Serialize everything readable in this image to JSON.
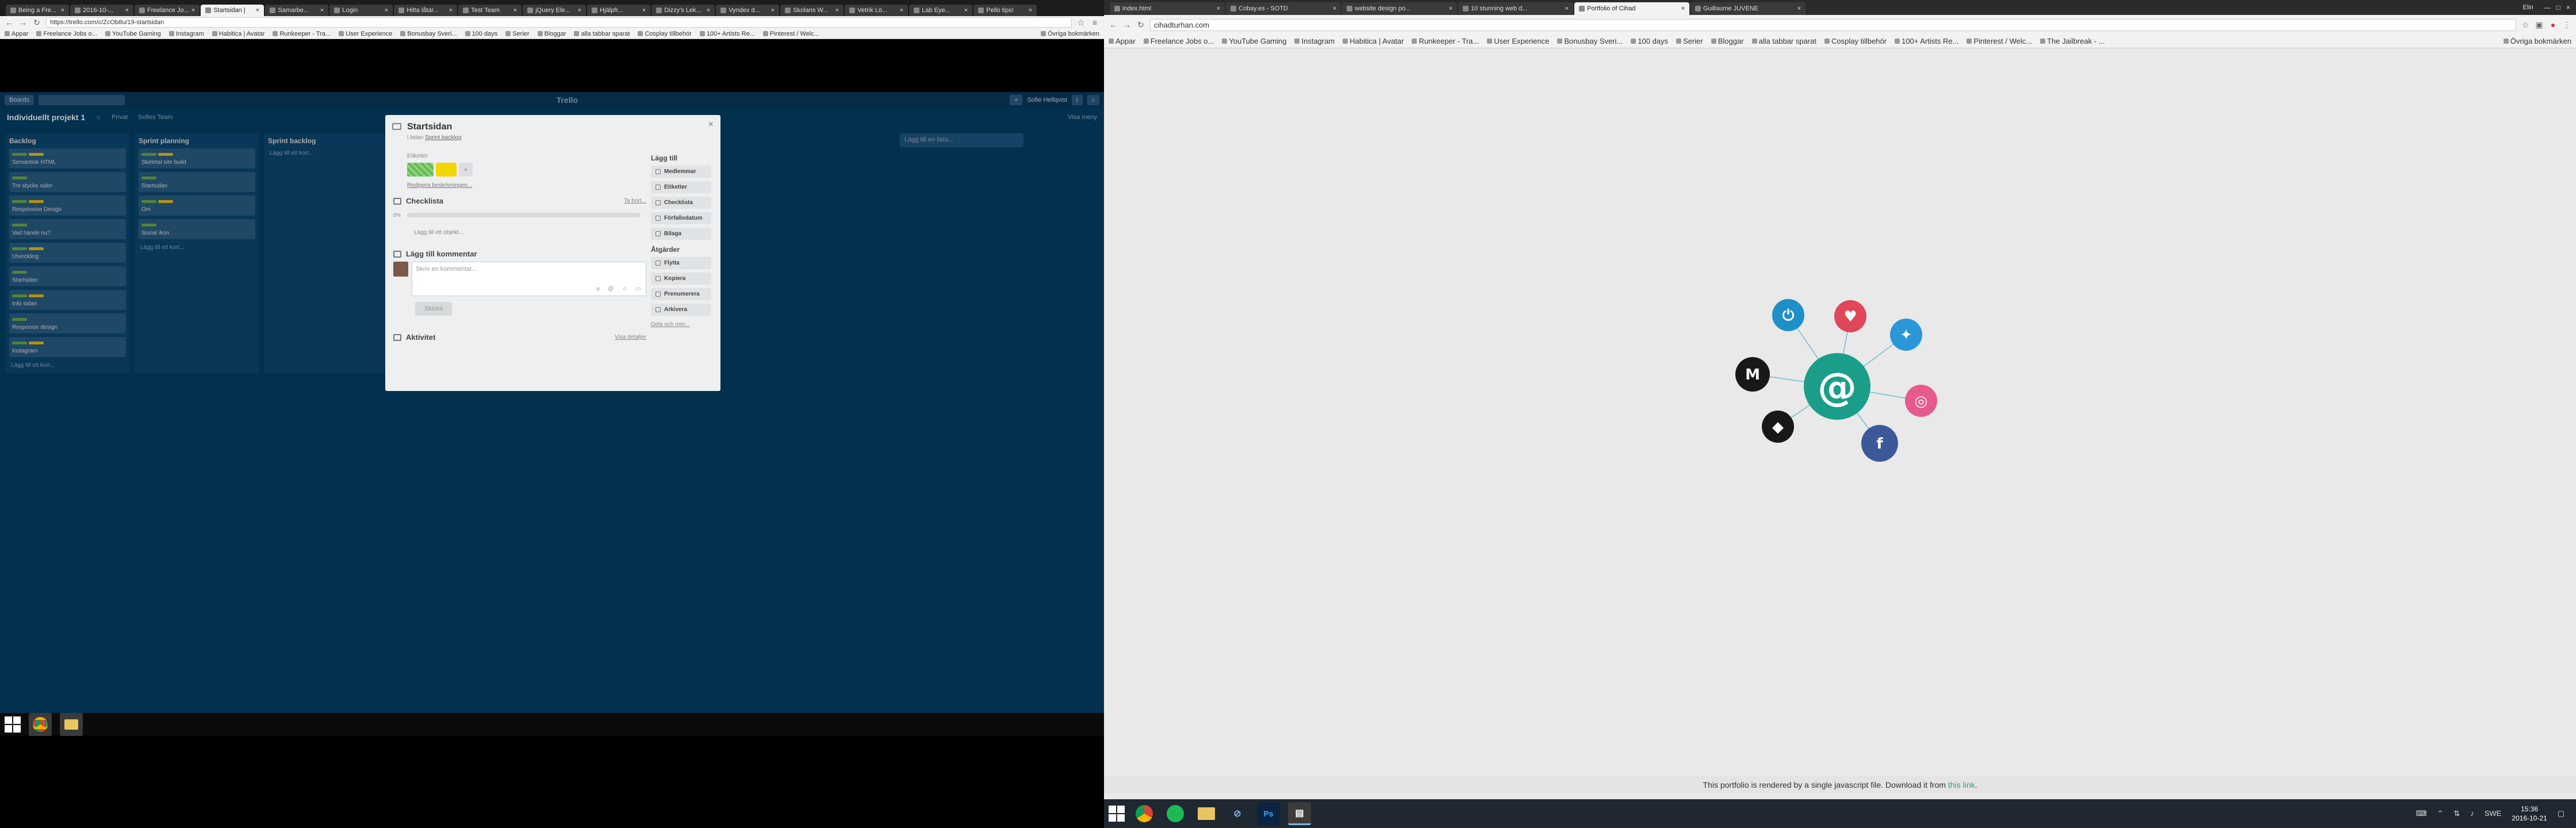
{
  "left": {
    "tabs": [
      "Being a Fre...",
      "2016-10-...",
      "Freelance Jo...",
      "Startsidan |",
      "Samarbe...",
      "Login",
      "Hitta låtar...",
      "Test Team",
      "jQuery Ele...",
      "Hjälpfr...",
      "Dizzy's Lek...",
      "Vyndex d...",
      "Skolans W...",
      "Vetrik Lö...",
      "Lab Eye...",
      "Pello tips!"
    ],
    "active_tab_index": 3,
    "url": "https://trello.com/c/ZcOb8u/19-startsidan",
    "bookmarks": [
      "Appar",
      "Freelance Jobs o...",
      "YouTube Gaming",
      "Instagram",
      "Habitica | Avatar",
      "Runkeeper - Tra...",
      "User Experience",
      "Bonusbay Sveri...",
      "100 days",
      "Serier",
      "Bloggar",
      "alla tabbar sparat",
      "Cosplay tillbehör",
      "100+ Artists Re...",
      "Pinterest / Welc..."
    ],
    "bookmarks_right": "Övriga bokmärken",
    "trello": {
      "header_boards": "Boards",
      "logo": "Trello",
      "user": "Sofie Hellqvist",
      "board_name": "Individuellt projekt 1",
      "board_private": "Privat",
      "board_team": "Sofies Team",
      "board_menu": "Visa meny",
      "lists": [
        {
          "title": "Backlog",
          "cards": [
            "Semantisk HTML",
            "Tre stycke sidor",
            "Responsive Design",
            "Vad hände nu?",
            "Utveckling",
            "Startsidan",
            "Info sidan",
            "Responsiv design",
            "Instagram"
          ],
          "add": "Lägg till ett kort..."
        },
        {
          "title": "Sprint planning",
          "cards": [
            "Skeletal site build",
            "Startsidan",
            "Om",
            "Social ikon"
          ],
          "add": "Lägg till ett kort..."
        },
        {
          "title": "Sprint backlog",
          "cards": [],
          "add": "Lägg till ett kort..."
        }
      ],
      "add_list": "Lägg till en lista..."
    },
    "modal": {
      "title": "Startsidan",
      "sub_prefix": "i listan",
      "sub_list": "Sprint backlog",
      "labels_title": "Etiketter",
      "edit_desc": "Redigera beskrivningen...",
      "checklist_title": "Checklista",
      "checklist_hide": "Ta bort...",
      "checklist_pct": "0%",
      "checklist_add": "Lägg till ett objekt...",
      "comment_title": "Lägg till kommentar",
      "comment_placeholder": "Skriv en kommentar...",
      "save": "Skicka",
      "activity_title": "Aktivitet",
      "activity_details": "Visa detaljer",
      "side_add_title": "Lägg till",
      "side_add": [
        "Medlemmar",
        "Etiketter",
        "Checklista",
        "Förfallodatum",
        "Bilaga"
      ],
      "side_actions_title": "Åtgärder",
      "side_actions": [
        "Flytta",
        "Kopiera",
        "Prenumerera",
        "Arkivera"
      ],
      "share": "Dela och mer..."
    }
  },
  "right": {
    "tabs": [
      "index.html",
      "Cobay.es - SOTD",
      "website design po...",
      "10 stunning web d...",
      "Portfolio of Cihad",
      "Guillaume JUVENE"
    ],
    "active_tab_index": 4,
    "window_user": "Elin",
    "url": "cihadturhan.com",
    "bookmarks": [
      "Appar",
      "Freelance Jobs o...",
      "YouTube Gaming",
      "Instagram",
      "Habitica | Avatar",
      "Runkeeper - Tra...",
      "User Experience",
      "Bonusbay Sveri...",
      "100 days",
      "Serier",
      "Bloggar",
      "alla tabbar sparat",
      "Cosplay tillbehör",
      "100+ Artists Re...",
      "Pinterest / Welc...",
      "The Jailbreak - ..."
    ],
    "bookmarks_right": "Övriga bokmärken",
    "center_icon": "@",
    "social": [
      {
        "name": "power-icon",
        "glyph": "⏻",
        "color": "#1f8fc9"
      },
      {
        "name": "pocket-icon",
        "glyph": "♥",
        "color": "#e0475a"
      },
      {
        "name": "twitter-icon",
        "glyph": "✦",
        "color": "#2a97d9"
      },
      {
        "name": "dribbble-icon",
        "glyph": "◎",
        "color": "#e75a8d"
      },
      {
        "name": "facebook-icon",
        "glyph": "f",
        "color": "#3b5999"
      },
      {
        "name": "github-icon",
        "glyph": "◆",
        "color": "#181818"
      },
      {
        "name": "medium-icon",
        "glyph": "M",
        "color": "#181818"
      }
    ],
    "footer_text": "This portfolio is rendered by a single javascript file. Download it from ",
    "footer_link": "this link",
    "footer_end": ".",
    "clock_time": "15:36",
    "clock_date": "2016-10-21",
    "lang": "SWE"
  }
}
